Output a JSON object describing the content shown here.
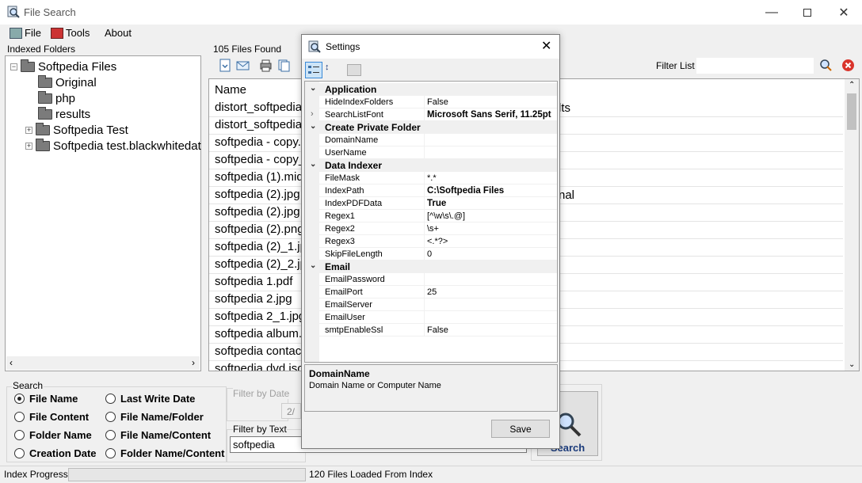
{
  "window": {
    "title": "File Search"
  },
  "menu": {
    "file": "File",
    "tools": "Tools",
    "about": "About"
  },
  "left_panel": {
    "label": "Indexed Folders"
  },
  "tree": {
    "root": "Softpedia Files",
    "children": [
      "Original",
      "php",
      "results"
    ],
    "siblings": [
      "Softpedia Test",
      "Softpedia test.blackwhitedat"
    ]
  },
  "results": {
    "count_label": "105 Files Found",
    "filter_label": "Filter List",
    "column_header": "Name",
    "rows": [
      "distort_softpedia",
      "distort_softpedia",
      "softpedia - copy.",
      "softpedia - copy_",
      "softpedia (1).mid",
      "softpedia (2).jpg",
      "softpedia (2).jpg",
      "softpedia (2).png",
      "softpedia (2)_1.jp",
      "softpedia (2)_2.jp",
      "softpedia 1.pdf",
      "softpedia 2.jpg",
      "softpedia 2_1.jpg",
      "softpedia album.",
      "softpedia contac",
      "softpedia dvd.iso"
    ],
    "right_fragments": {
      "row1": "lts",
      "row6": "nal"
    }
  },
  "search": {
    "group_label": "Search",
    "options": [
      {
        "label": "File Name",
        "selected": true
      },
      {
        "label": "File Content",
        "selected": false
      },
      {
        "label": "Folder Name",
        "selected": false
      },
      {
        "label": "Creation Date",
        "selected": false
      },
      {
        "label": "Last Write Date",
        "selected": false
      },
      {
        "label": "File Name/Folder",
        "selected": false
      },
      {
        "label": "File Name/Content",
        "selected": false
      },
      {
        "label": "Folder Name/Content",
        "selected": false
      }
    ],
    "filter_date_label": "Filter by Date",
    "filter_date_value": "2/",
    "filter_text_label": "Filter by Text",
    "filter_text_value": "softpedia",
    "search_button": "Search"
  },
  "status": {
    "label": "Index Progress",
    "message": "120 Files Loaded From Index",
    "progress": 0
  },
  "settings_dialog": {
    "title": "Settings",
    "categories": [
      {
        "name": "Application",
        "props": [
          {
            "name": "HideIndexFolders",
            "value": "False",
            "bold": false
          },
          {
            "name": "SearchListFont",
            "value": "Microsoft Sans Serif, 11.25pt",
            "bold": true
          }
        ]
      },
      {
        "name": "Create Private Folder",
        "props": [
          {
            "name": "DomainName",
            "value": "",
            "bold": false
          },
          {
            "name": "UserName",
            "value": "",
            "bold": false
          }
        ]
      },
      {
        "name": "Data Indexer",
        "props": [
          {
            "name": "FileMask",
            "value": "*.*",
            "bold": false
          },
          {
            "name": "IndexPath",
            "value": "C:\\Softpedia Files",
            "bold": true
          },
          {
            "name": "IndexPDFData",
            "value": "True",
            "bold": true
          },
          {
            "name": "Regex1",
            "value": "[^\\w\\s\\.@]",
            "bold": false
          },
          {
            "name": "Regex2",
            "value": "\\s+",
            "bold": false
          },
          {
            "name": "Regex3",
            "value": "<.*?>",
            "bold": false
          },
          {
            "name": "SkipFileLength",
            "value": "0",
            "bold": false
          }
        ]
      },
      {
        "name": "Email",
        "props": [
          {
            "name": "EmailPassword",
            "value": "",
            "bold": false
          },
          {
            "name": "EmailPort",
            "value": "25",
            "bold": false
          },
          {
            "name": "EmailServer",
            "value": "",
            "bold": false
          },
          {
            "name": "EmailUser",
            "value": "",
            "bold": false
          },
          {
            "name": "smtpEnableSsl",
            "value": "False",
            "bold": false
          }
        ]
      }
    ],
    "description_title": "DomainName",
    "description_text": "Domain Name or Computer Name",
    "save_button": "Save"
  }
}
